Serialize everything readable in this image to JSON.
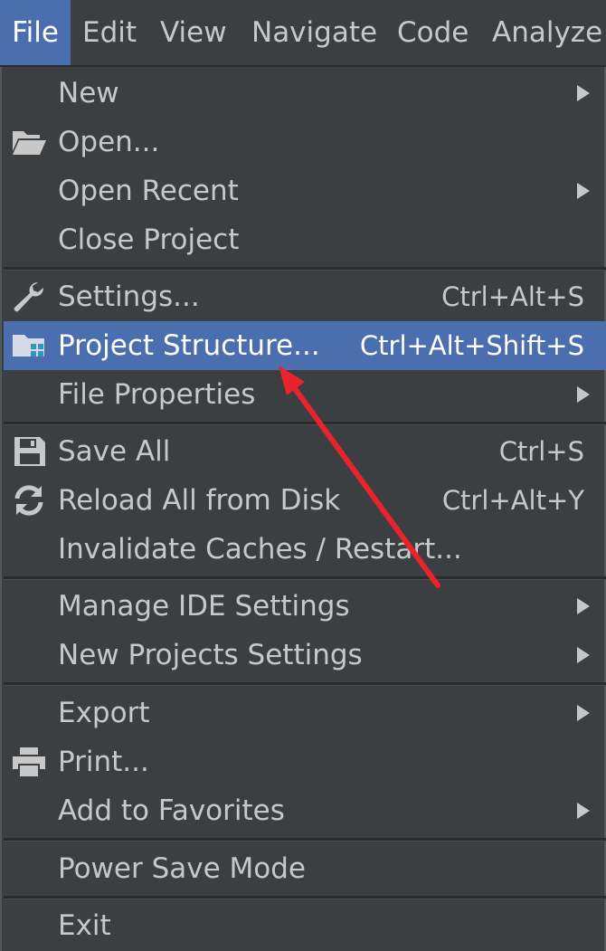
{
  "menubar": {
    "items": [
      {
        "label": "File"
      },
      {
        "label": "Edit"
      },
      {
        "label": "View"
      },
      {
        "label": "Navigate"
      },
      {
        "label": "Code"
      },
      {
        "label": "Analyze"
      }
    ]
  },
  "file_menu": {
    "new": {
      "label": "New"
    },
    "open": {
      "label": "Open...",
      "icon": "folder-open-icon"
    },
    "open_recent": {
      "label": "Open Recent"
    },
    "close_project": {
      "label": "Close Project"
    },
    "settings": {
      "label": "Settings...",
      "shortcut": "Ctrl+Alt+S",
      "icon": "wrench-icon"
    },
    "project_structure": {
      "label": "Project Structure...",
      "shortcut": "Ctrl+Alt+Shift+S",
      "icon": "project-structure-icon"
    },
    "file_properties": {
      "label": "File Properties"
    },
    "save_all": {
      "label": "Save All",
      "shortcut": "Ctrl+S",
      "icon": "save-icon"
    },
    "reload_all": {
      "label": "Reload All from Disk",
      "shortcut": "Ctrl+Alt+Y",
      "icon": "reload-icon"
    },
    "invalidate_caches": {
      "label": "Invalidate Caches / Restart..."
    },
    "manage_ide_settings": {
      "label": "Manage IDE Settings"
    },
    "new_projects_settings": {
      "label": "New Projects Settings"
    },
    "export": {
      "label": "Export"
    },
    "print": {
      "label": "Print...",
      "icon": "printer-icon"
    },
    "add_to_favorites": {
      "label": "Add to Favorites"
    },
    "power_save_mode": {
      "label": "Power Save Mode"
    },
    "exit": {
      "label": "Exit"
    }
  },
  "colors": {
    "background": "#3c3f41",
    "selection": "#4b6eaf",
    "text": "#c8c8c8",
    "annotation_arrow": "#e8232b"
  }
}
